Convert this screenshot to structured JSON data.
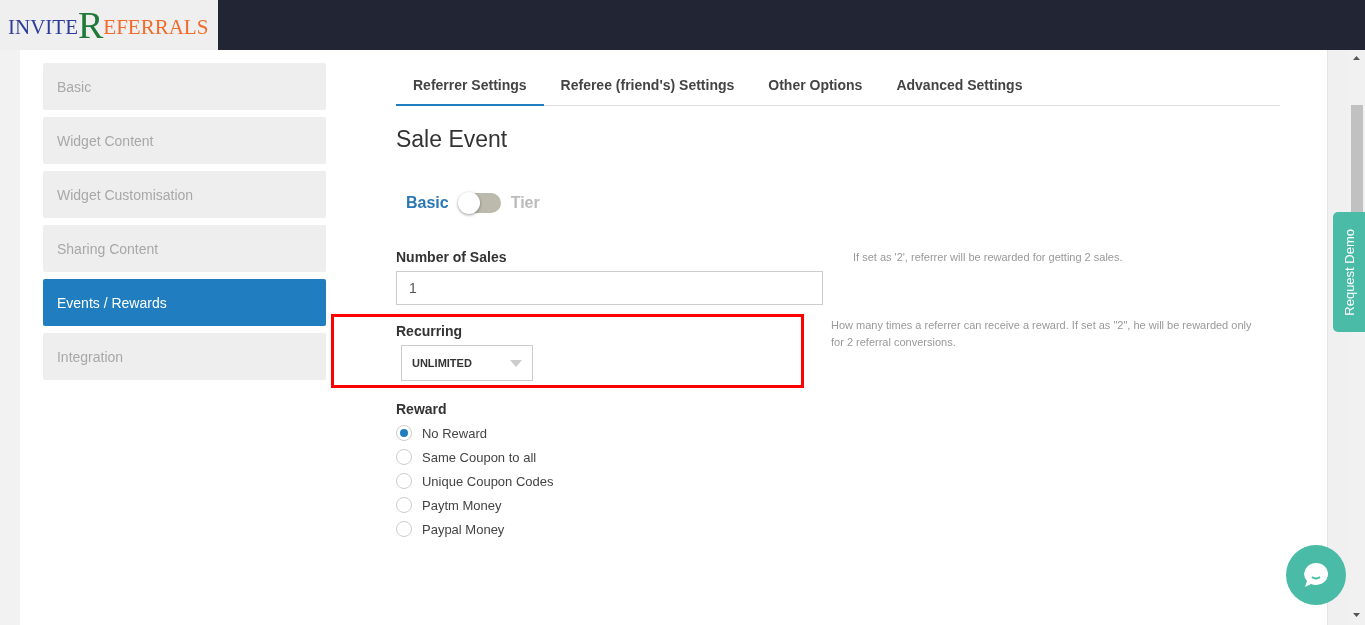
{
  "logo": {
    "parts": [
      {
        "text": "INVITE",
        "color": "#2e3c9a"
      },
      {
        "text": "R",
        "color": "#1f7a3a"
      },
      {
        "text": "EFERRALS",
        "color": "#f26b2a"
      }
    ]
  },
  "sidebar": {
    "items": [
      {
        "label": "Basic",
        "selected": false
      },
      {
        "label": "Widget Content",
        "selected": false
      },
      {
        "label": "Widget Customisation",
        "selected": false
      },
      {
        "label": "Sharing Content",
        "selected": false
      },
      {
        "label": "Events / Rewards",
        "selected": true
      },
      {
        "label": "Integration",
        "selected": false
      }
    ]
  },
  "tabs": [
    {
      "label": "Referrer Settings",
      "selected": true
    },
    {
      "label": "Referee (friend's) Settings",
      "selected": false
    },
    {
      "label": "Other Options",
      "selected": false
    },
    {
      "label": "Advanced Settings",
      "selected": false
    }
  ],
  "heading": "Sale Event",
  "mode_switch": {
    "left_label": "Basic",
    "right_label": "Tier",
    "on": false
  },
  "fields": [
    {
      "kind": "text",
      "label": "Number of Sales",
      "value": "1",
      "help": "If set as '2', referrer will be rewarded for getting 2 sales.",
      "highlighted": false
    },
    {
      "kind": "select",
      "label": "Recurring",
      "value": "UNLIMITED",
      "help": "How many times a referrer can receive a reward. If set as \"2\", he will be rewarded only for 2 referral conversions.",
      "highlighted": true
    }
  ],
  "reward": {
    "label": "Reward",
    "options": [
      {
        "label": "No Reward",
        "selected": true
      },
      {
        "label": "Same Coupon to all",
        "selected": false
      },
      {
        "label": "Unique Coupon Codes",
        "selected": false
      },
      {
        "label": "Paytm Money",
        "selected": false
      },
      {
        "label": "Paypal Money",
        "selected": false
      }
    ]
  },
  "request_demo": "Request Demo"
}
